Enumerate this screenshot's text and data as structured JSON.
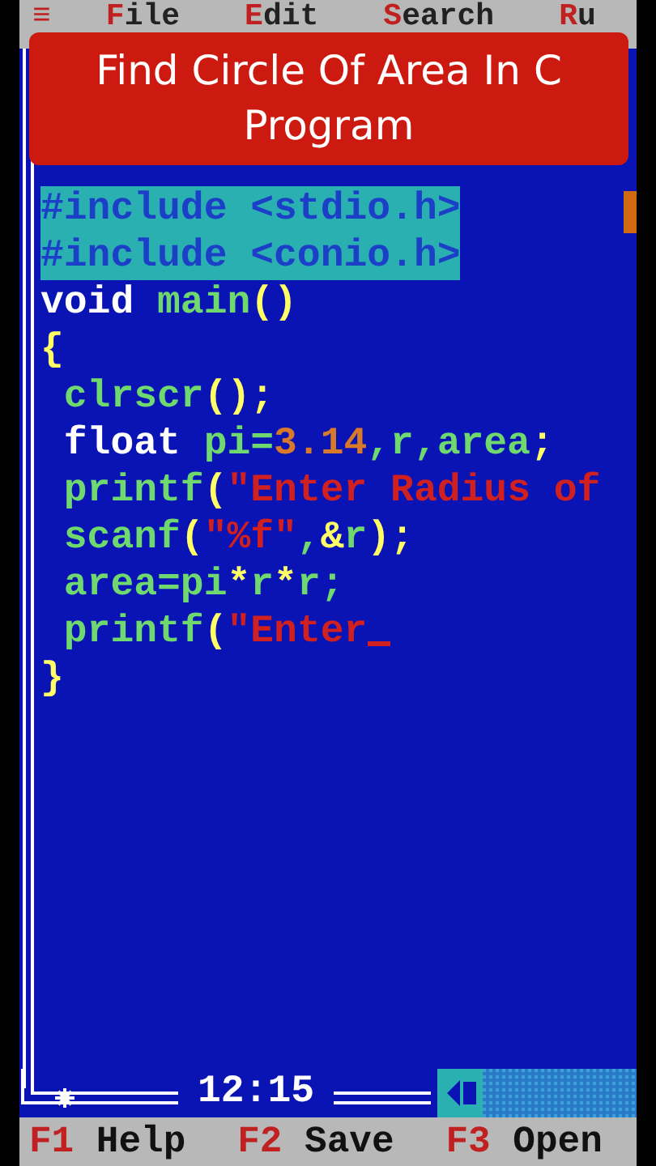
{
  "menu_bar": {
    "system_icon": "≡",
    "items": [
      {
        "hotkey": "F",
        "rest": "ile"
      },
      {
        "hotkey": "E",
        "rest": "dit"
      },
      {
        "hotkey": "S",
        "rest": "earch"
      },
      {
        "hotkey": "R",
        "rest": "u"
      }
    ]
  },
  "banner": {
    "title": "Find Circle Of Area In C Program"
  },
  "editor": {
    "lines": [
      {
        "selected": true,
        "tokens": [
          {
            "kind": "directive",
            "text": "#include <stdio.h>"
          }
        ]
      },
      {
        "selected": true,
        "tokens": [
          {
            "kind": "directive",
            "text": "#include <conio.h>"
          }
        ]
      },
      {
        "selected": false,
        "tokens": [
          {
            "kind": "keyword",
            "text": "void"
          },
          {
            "kind": "ident",
            "text": " main"
          },
          {
            "kind": "punct",
            "text": "()"
          }
        ]
      },
      {
        "selected": false,
        "tokens": [
          {
            "kind": "punct",
            "text": "{"
          }
        ]
      },
      {
        "selected": false,
        "tokens": [
          {
            "kind": "ident",
            "text": " clrscr"
          },
          {
            "kind": "punct",
            "text": "();"
          }
        ]
      },
      {
        "selected": false,
        "tokens": [
          {
            "kind": "keyword",
            "text": " float"
          },
          {
            "kind": "ident",
            "text": " pi="
          },
          {
            "kind": "number",
            "text": "3.14"
          },
          {
            "kind": "ident",
            "text": ",r,area"
          },
          {
            "kind": "punct",
            "text": ";"
          }
        ]
      },
      {
        "selected": false,
        "tokens": [
          {
            "kind": "ident",
            "text": " printf"
          },
          {
            "kind": "punct",
            "text": "("
          },
          {
            "kind": "string",
            "text": "\"Enter Radius of"
          }
        ]
      },
      {
        "selected": false,
        "tokens": [
          {
            "kind": "ident",
            "text": " scanf"
          },
          {
            "kind": "punct",
            "text": "("
          },
          {
            "kind": "string",
            "text": "\"%f\""
          },
          {
            "kind": "ident",
            "text": ","
          },
          {
            "kind": "punct",
            "text": "&"
          },
          {
            "kind": "ident",
            "text": "r"
          },
          {
            "kind": "punct",
            "text": ");"
          }
        ]
      },
      {
        "selected": false,
        "tokens": [
          {
            "kind": "ident",
            "text": " area=pi"
          },
          {
            "kind": "punct",
            "text": "*"
          },
          {
            "kind": "ident",
            "text": "r"
          },
          {
            "kind": "punct",
            "text": "*"
          },
          {
            "kind": "ident",
            "text": "r;"
          }
        ]
      },
      {
        "selected": false,
        "cursor": true,
        "tokens": [
          {
            "kind": "ident",
            "text": " printf"
          },
          {
            "kind": "punct",
            "text": "("
          },
          {
            "kind": "string",
            "text": "\"Enter"
          }
        ]
      },
      {
        "selected": false,
        "tokens": [
          {
            "kind": "punct",
            "text": "}"
          }
        ]
      }
    ],
    "cursor_position": "12:15"
  },
  "function_keys": [
    {
      "key": "F1",
      "label": "Help"
    },
    {
      "key": "F2",
      "label": "Save"
    },
    {
      "key": "F3",
      "label": "Open"
    }
  ]
}
